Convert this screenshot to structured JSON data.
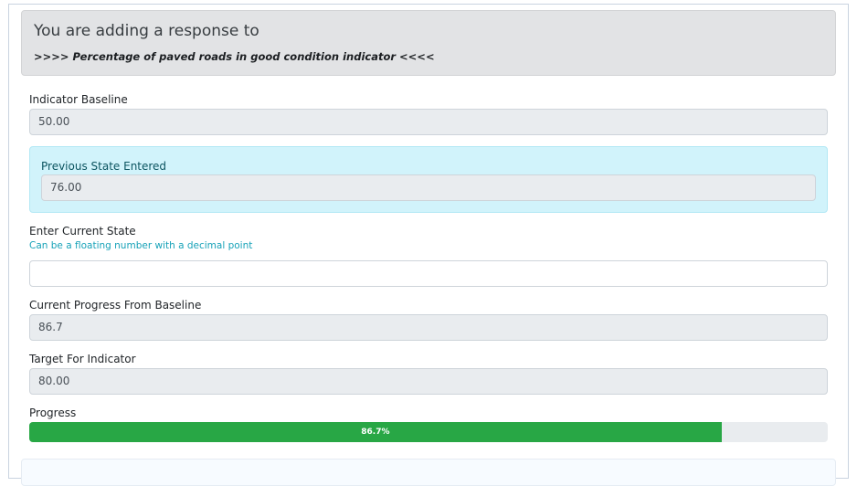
{
  "header": {
    "title": "You are adding a response to",
    "indicator": ">>>> Percentage of paved roads in good condition indicator <<<<"
  },
  "baseline": {
    "label": "Indicator Baseline",
    "value": "50.00"
  },
  "previous_state": {
    "label": "Previous State Entered",
    "value": "76.00"
  },
  "current_state": {
    "label": "Enter Current State",
    "help": "Can be a floating number with a decimal point",
    "value": "",
    "placeholder": ""
  },
  "current_progress": {
    "label": "Current Progress From Baseline",
    "value": "86.7"
  },
  "target": {
    "label": "Target For Indicator",
    "value": "80.00"
  },
  "progress": {
    "label": "Progress",
    "text": "86.7%",
    "percent": 86.7,
    "color": "#28a745"
  }
}
